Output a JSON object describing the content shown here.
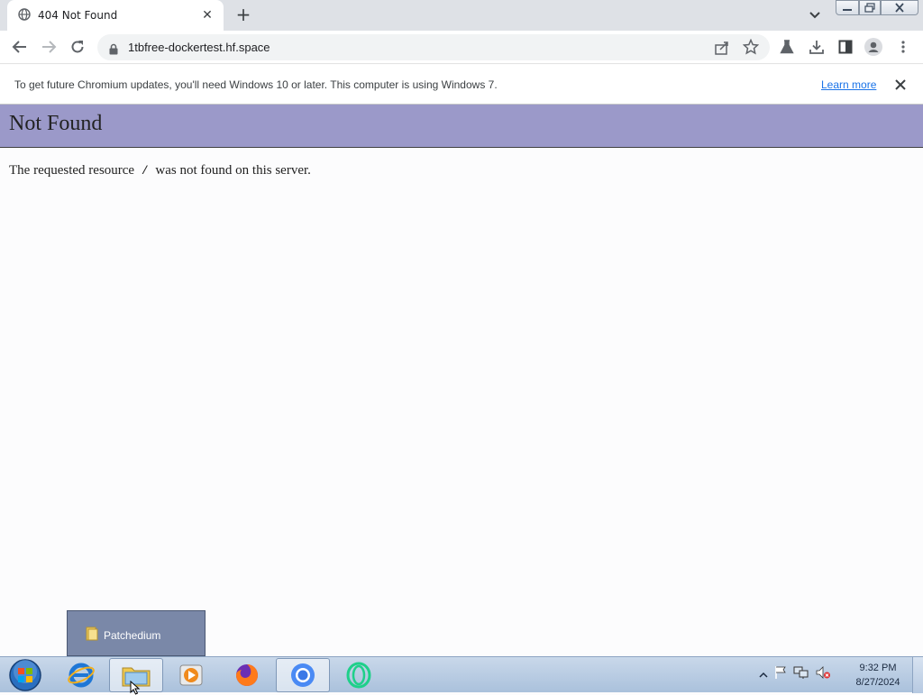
{
  "browser": {
    "tab": {
      "title": "404 Not Found"
    },
    "address": {
      "url": "1tbfree-dockertest.hf.space"
    }
  },
  "infobar": {
    "message": "To get future Chromium updates, you'll need Windows 10 or later. This computer is using Windows 7.",
    "link": "Learn more"
  },
  "page": {
    "heading": "Not Found",
    "body_prefix": "The requested resource",
    "resource": "/",
    "body_suffix": "was not found on this server."
  },
  "jump_popup": {
    "item": "Patchedium"
  },
  "taskbar": {
    "time": "9:32 PM",
    "date": "8/27/2024"
  },
  "colors": {
    "header_bg": "#9b99c9",
    "taskbar_bg": "#aac1dc",
    "link": "#1a73e8"
  }
}
